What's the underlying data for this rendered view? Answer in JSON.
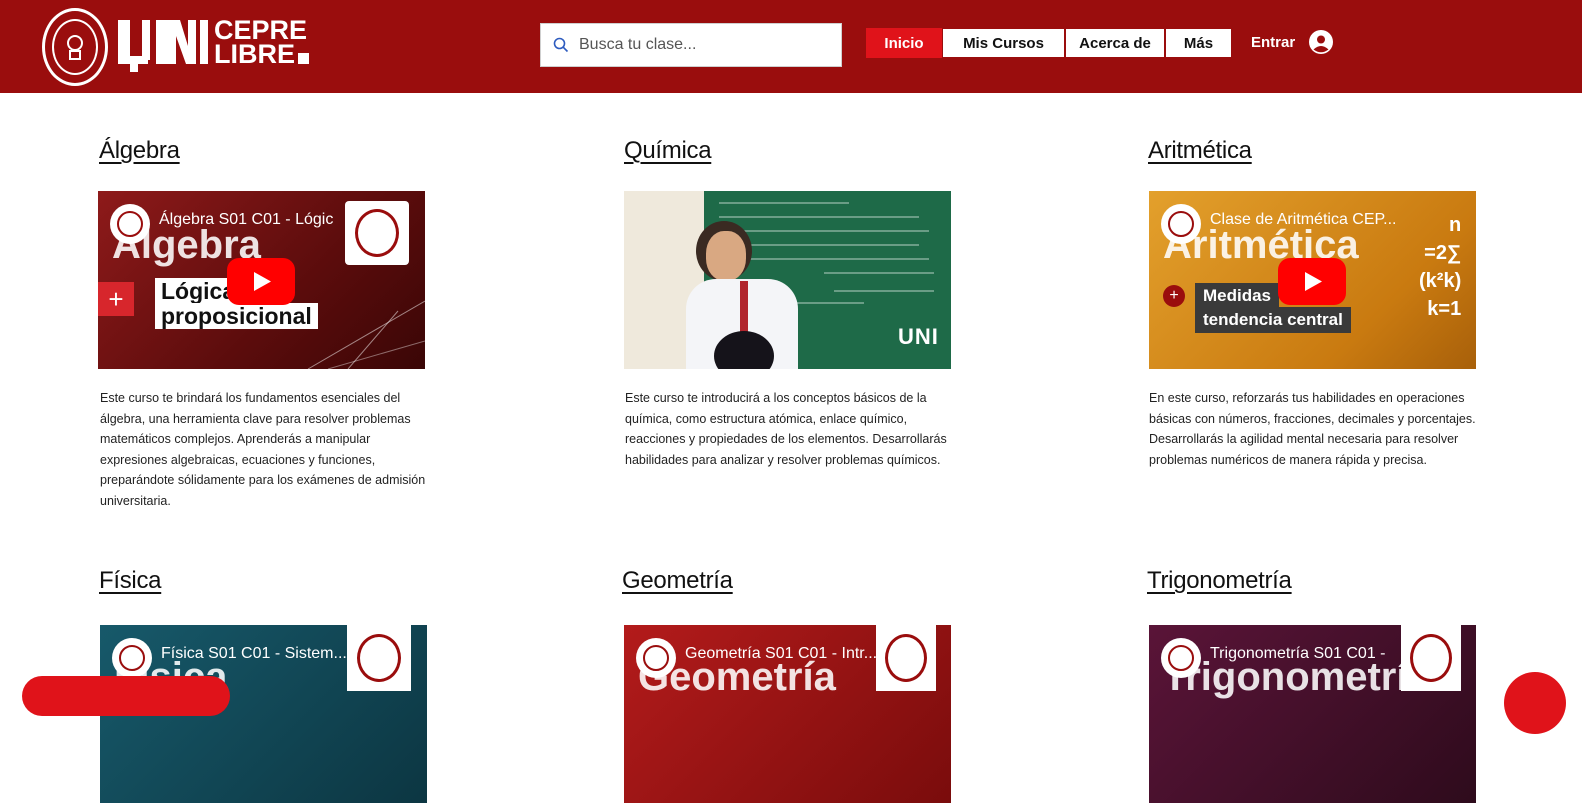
{
  "brand": {
    "logo_mark": "UNI",
    "line1": "CEPRE",
    "line2": "LIBRE",
    "accent": "#9a0d0d"
  },
  "search": {
    "placeholder": "Busca tu clase...",
    "icon": "search-icon"
  },
  "nav": {
    "items": [
      {
        "label": "Inicio",
        "active": true
      },
      {
        "label": "Mis Cursos",
        "active": false
      },
      {
        "label": "Acerca de",
        "active": false
      },
      {
        "label": "Más",
        "active": false
      }
    ],
    "login_label": "Entrar",
    "login_icon": "user-avatar-icon"
  },
  "courses": [
    {
      "title": "Álgebra",
      "video_title": "Álgebra S01 C01 - Lógic",
      "thumb_big": "Álgebra",
      "thumb_sub1": "Lógica",
      "thumb_sub2": "proposicional",
      "description": "Este curso te brindará los fundamentos esenciales del álgebra, una herramienta clave para resolver problemas matemáticos complejos. Aprenderás a manipular expresiones algebraicas, ecuaciones y funciones, preparándote sólidamente para los exámenes de admisión universitaria.",
      "thumb_color": "#7a1414"
    },
    {
      "title": "Química",
      "video_title": "",
      "thumb_big": "",
      "thumb_watermark": "UNI",
      "description": "Este curso te introducirá a los conceptos básicos de la química, como estructura atómica, enlace químico, reacciones y propiedades de los elementos. Desarrollarás habilidades para analizar y resolver problemas químicos.",
      "thumb_color": "#1f5a3a"
    },
    {
      "title": "Aritmética",
      "video_title": "Clase de Aritmética CEP...",
      "thumb_big": "Aritmética",
      "thumb_sub1": "Medidas",
      "thumb_sub2": "tendencia central",
      "description": "En este curso, reforzarás tus habilidades en operaciones básicas con números, fracciones, decimales y porcentajes. Desarrollarás la agilidad mental necesaria para resolver problemas numéricos de manera rápida y precisa.",
      "thumb_color": "#d98a14"
    },
    {
      "title": "Física",
      "video_title": "Física S01 C01 - Sistem...",
      "thumb_big": "Física",
      "description": "",
      "thumb_color": "#0f4a57"
    },
    {
      "title": "Geometría",
      "video_title": "Geometría S01 C01 - Intr...",
      "thumb_big": "Geometría",
      "description": "",
      "thumb_color": "#a11616"
    },
    {
      "title": "Trigonometría",
      "video_title": "Trigonometría S01 C01 -",
      "thumb_big": "Trigonometría",
      "description": "",
      "thumb_color": "#4a1030"
    }
  ]
}
